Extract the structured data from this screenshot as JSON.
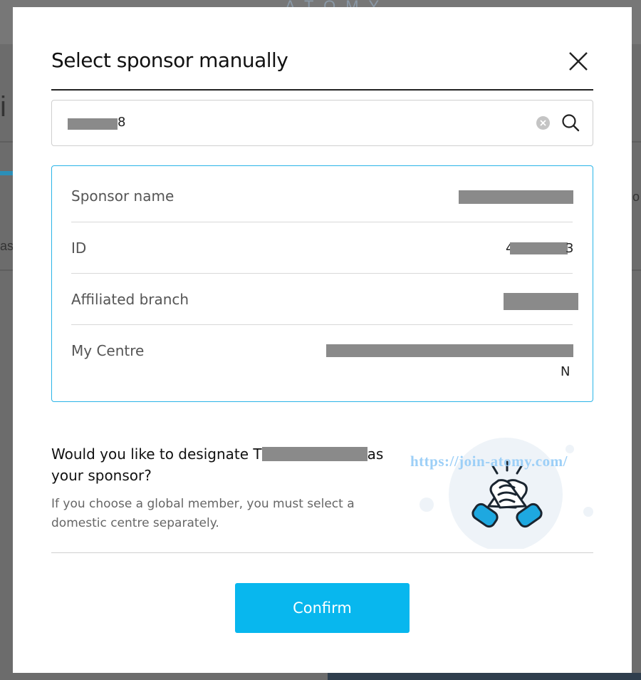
{
  "background": {
    "logo_text": "ATOMY",
    "left_fragment_1": "i",
    "left_fragment_2": "as",
    "right_fragment": "o"
  },
  "modal": {
    "title": "Select sponsor manually",
    "close_icon": "close-icon",
    "search": {
      "value_suffix": "8",
      "clear_icon": "clear-icon",
      "search_icon": "search-icon"
    },
    "sponsor_info": {
      "rows": [
        {
          "label": "Sponsor name",
          "value": ""
        },
        {
          "label": "ID",
          "value_visible_prefix": "4",
          "value_visible_suffix": "3"
        },
        {
          "label": "Affiliated branch",
          "value": ""
        },
        {
          "label": "My Centre",
          "value_trailing": "N"
        }
      ]
    },
    "question": {
      "prefix": "Would you like to designate T",
      "suffix": "as your sponsor?"
    },
    "note": "If you choose a global member, you must select a domestic centre separately.",
    "watermark": "https://join-atomy.com/",
    "illustration_icon": "handshake-icon",
    "confirm_label": "Confirm",
    "colors": {
      "accent": "#08b7ee",
      "card_border": "#2ab4e8",
      "redaction": "#8a8a8a"
    }
  }
}
